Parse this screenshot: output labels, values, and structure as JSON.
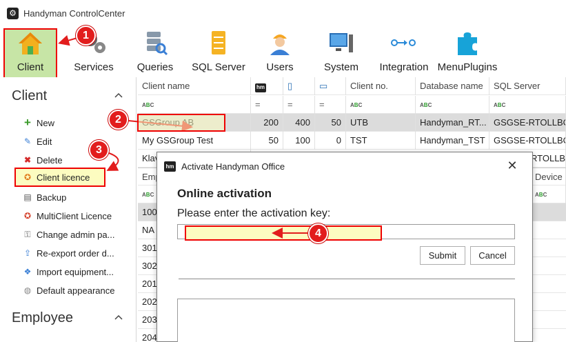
{
  "window": {
    "title": "Handyman ControlCenter"
  },
  "ribbon": {
    "client": "Client",
    "services": "Services",
    "queries": "Queries",
    "sql_server": "SQL Server",
    "users": "Users",
    "system": "System",
    "integration": "Integration",
    "menu_plugins": "MenuPlugins"
  },
  "sidebar": {
    "client_header": "Client",
    "items": [
      {
        "label": "New",
        "icon": "plus-icon"
      },
      {
        "label": "Edit",
        "icon": "edit-icon"
      },
      {
        "label": "Delete",
        "icon": "delete-icon"
      },
      {
        "label": "Client licence",
        "icon": "licence-icon"
      },
      {
        "label": "Backup",
        "icon": "backup-icon"
      },
      {
        "label": "MultiClient Licence",
        "icon": "multiclient-licence-icon"
      },
      {
        "label": "Change admin pa...",
        "icon": "key-icon"
      },
      {
        "label": "Re-export order d...",
        "icon": "export-icon"
      },
      {
        "label": "Import equipment...",
        "icon": "import-icon"
      },
      {
        "label": "Default appearance",
        "icon": "appearance-icon"
      }
    ],
    "employee_header": "Employee"
  },
  "grid": {
    "columns": {
      "client_name": "Client name",
      "client_no": "Client no.",
      "database_name": "Database name",
      "sql_server": "SQL Server"
    },
    "rows": [
      {
        "name": "GSGroup AB",
        "v1": "200",
        "v2": "400",
        "v3": "50",
        "no": "UTB",
        "db": "Handyman_RT...",
        "server": "GSGSE-RTOLLBOM"
      },
      {
        "name": "My GSGroup Test",
        "v1": "50",
        "v2": "100",
        "v3": "0",
        "no": "TST",
        "db": "Handyman_TST",
        "server": "GSGSE-RTOLLBOM"
      },
      {
        "name": "Klav",
        "server": "RTOLLBOM"
      }
    ],
    "employee": {
      "header_start": "Emp",
      "header_device": "Device n",
      "rows": [
        "100",
        "NA",
        "301",
        "302",
        "201",
        "202",
        "203",
        "204"
      ]
    }
  },
  "dialog": {
    "title": "Activate Handyman Office",
    "heading": "Online activation",
    "label": "Please enter the activation key:",
    "key_value": "",
    "submit": "Submit",
    "cancel": "Cancel"
  },
  "annotations": {
    "step1": "1",
    "step2": "2",
    "step3": "3",
    "step4": "4"
  },
  "colors": {
    "accent_red": "#e21d1d",
    "highlight_yellow": "#fcfcc0",
    "active_green": "#c7e5a6"
  }
}
